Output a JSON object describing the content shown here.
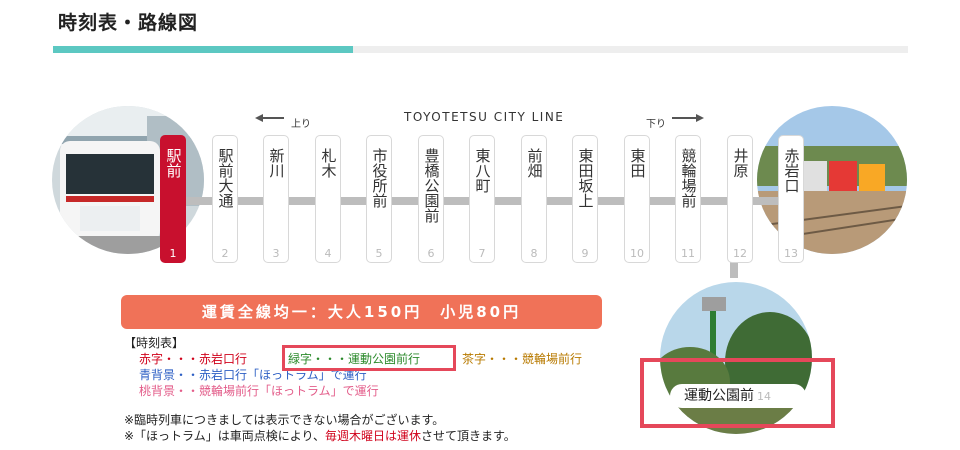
{
  "page_title": "時刻表・路線図",
  "line_name": "TOYOTETSU CITY LINE",
  "dir_up": "上り",
  "dir_down": "下り",
  "stations": [
    {
      "name": "駅前",
      "num": "1",
      "active": true
    },
    {
      "name": "駅前大通",
      "num": "2"
    },
    {
      "name": "新川",
      "num": "3"
    },
    {
      "name": "札木",
      "num": "4"
    },
    {
      "name": "市役所前",
      "num": "5"
    },
    {
      "name": "豊橋公園前",
      "num": "6"
    },
    {
      "name": "東八町",
      "num": "7"
    },
    {
      "name": "前畑",
      "num": "8"
    },
    {
      "name": "東田坂上",
      "num": "9"
    },
    {
      "name": "東田",
      "num": "10"
    },
    {
      "name": "競輪場前",
      "num": "11"
    },
    {
      "name": "井原",
      "num": "12"
    },
    {
      "name": "赤岩口",
      "num": "13"
    }
  ],
  "branch_station": {
    "name": "運動公園前",
    "num": "14"
  },
  "fare": "運賃全線均一：大人150円　小児80円",
  "timetable": {
    "heading": "【時刻表】",
    "red": "赤字・・・赤岩口行",
    "green": "緑字・・・運動公園前行",
    "brown": "茶字・・・競輪場前行",
    "blue": "青背景・・赤岩口行「ほっトラム」で運行",
    "pink": "桃背景・・競輪場前行「ほっトラム」で運行"
  },
  "notes": {
    "note1": "※臨時列車につきましては表示できない場合がございます。",
    "note2_a": "※「ほっトラム」は車両点検により、",
    "note2_b": "毎週木曜日は運休",
    "note2_c": "させて頂きます。"
  },
  "colors": {
    "accent": "#5cc8c2",
    "active_station": "#c8102e",
    "fare_bg": "#f07258",
    "highlight": "#e5485a"
  }
}
